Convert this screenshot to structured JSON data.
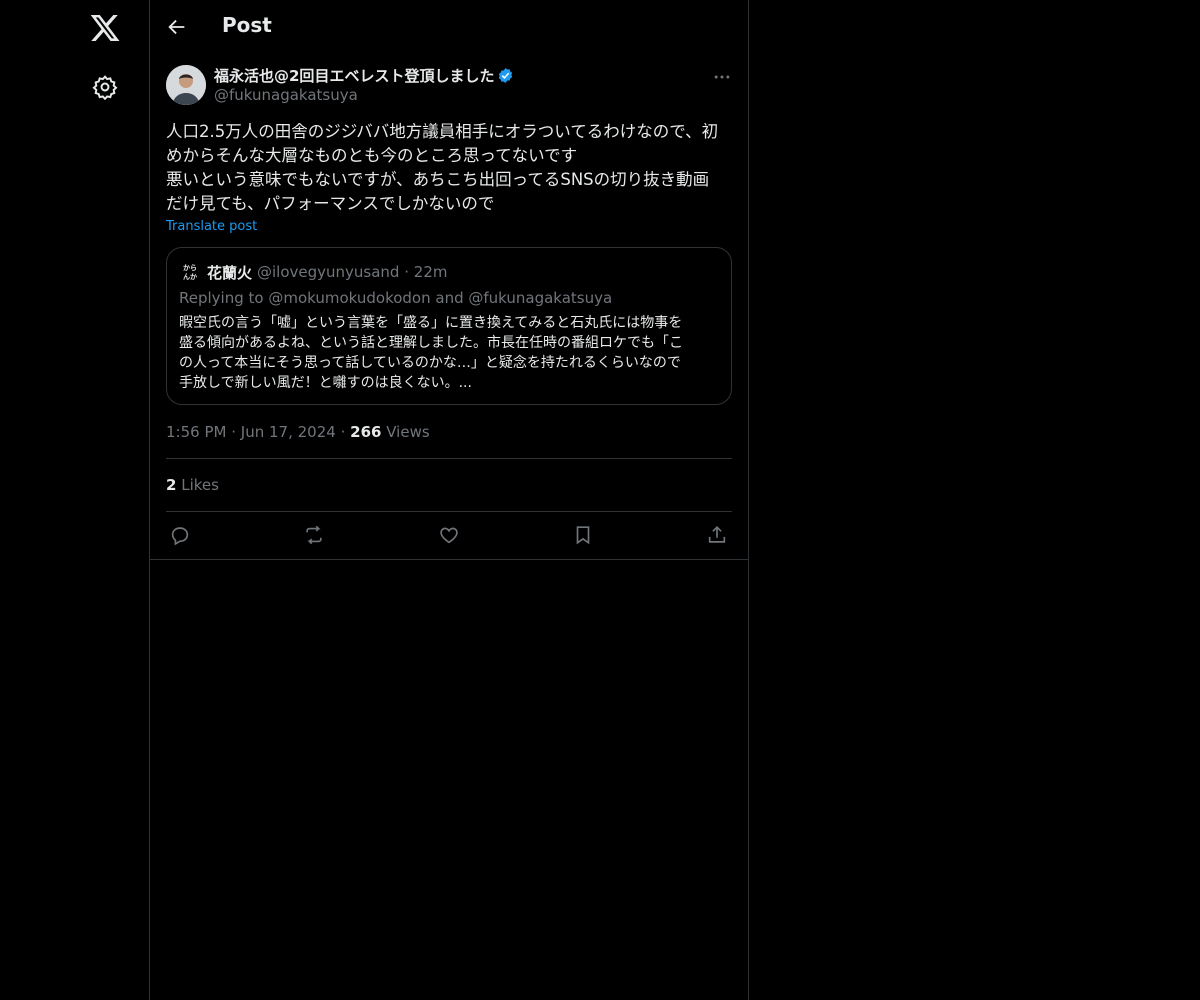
{
  "nav": {
    "logo_icon": "x-logo-icon",
    "settings_icon": "gear-icon"
  },
  "header": {
    "back_icon": "arrow-left-icon",
    "title": "Post"
  },
  "post": {
    "author_name": "福永活也@2回目エベレスト登頂しました",
    "author_handle": "@fukunagakatsuya",
    "verified": true,
    "text_lines": [
      "人口2.5万人の田舎のジジババ地方議員相手にオラついてるわけなので、初",
      "めからそんな大層なものとも今のところ思ってないです",
      "悪いという意味でもないですが、あちこち出回ってるSNSの切り抜き動画",
      "だけ見ても、パフォーマンスでしかないので"
    ],
    "translate_label": "Translate post",
    "time": "1:56 PM",
    "date": "Jun 17, 2024",
    "views_count": "266",
    "views_label": "Views",
    "likes_count": "2",
    "likes_label": "Likes",
    "separator": "·"
  },
  "quote": {
    "avatar_text": "から んか",
    "name": "花蘭火",
    "handle": "@ilovegyunyusand",
    "age": "22m",
    "separator": "·",
    "replying_to": "Replying to @mokumokudokodon and @fukunagakatsuya",
    "text_lines": [
      "暇空氏の言う「嘘」という言葉を「盛る」に置き換えてみると石丸氏には物事を",
      "盛る傾向があるよね、という話と理解しました。市長在任時の番組ロケでも「こ",
      "の人って本当にそう思って話しているのかな…」と疑念を持たれるくらいなので",
      "手放しで新しい風だ！と囃すのは良くない。..."
    ]
  },
  "actions": [
    "reply-icon",
    "repost-icon",
    "like-icon",
    "bookmark-icon",
    "share-icon"
  ],
  "colors": {
    "background": "#000000",
    "text": "#e7e9ea",
    "muted": "#71767b",
    "accent": "#1d9bf0",
    "border": "#2f3336"
  }
}
